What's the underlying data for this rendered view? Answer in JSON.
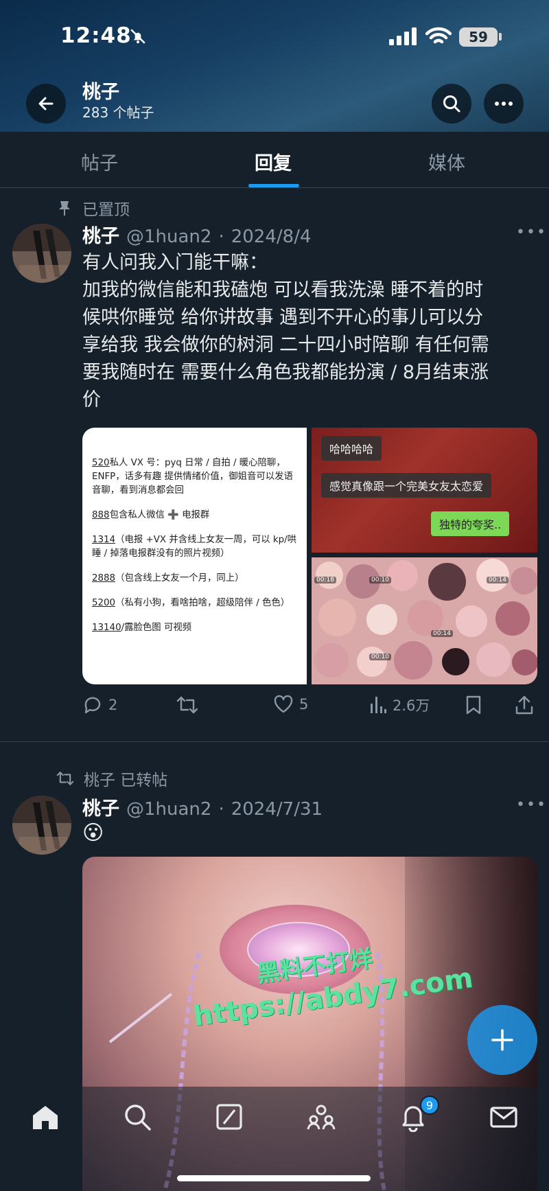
{
  "status_bar": {
    "time": "12:48",
    "battery": "59"
  },
  "header": {
    "name": "桃子",
    "post_count": "283 个帖子"
  },
  "tabs": [
    {
      "label": "帖子"
    },
    {
      "label": "回复"
    },
    {
      "label": "媒体"
    }
  ],
  "posts": [
    {
      "pinned_label": "已置顶",
      "name": "桃子",
      "handle": "@1huan2",
      "date": "2024/8/4",
      "text_lines": [
        "有人问我入门能干嘛：",
        "加我的微信能和我磕炮 可以看我洗澡 睡不着的时",
        "候哄你睡觉 给你讲故事  遇到不开心的事儿可以分",
        "享给我 我会做你的树洞 二十四小时陪聊 有任何需",
        "要我随时在  需要什么角色我都能扮演 / 8月结束涨",
        "价"
      ],
      "media": {
        "doc_lines": [
          [
            "520",
            "私人 VX 号：pyq 日常 / 自拍 / 暖心陪聊，ENFP，话多有趣 提供情绪价值，御姐音可以发语音聊，看到消息都会回"
          ],
          [
            "888",
            "包含私人微信 ➕ 电报群"
          ],
          [
            "1314",
            "（电报 +VX 并含线上女友一周，可以 kp/哄睡 / 掉落电报群没有的照片视频）"
          ],
          [
            "2888",
            "（包含线上女友一个月，同上）"
          ],
          [
            "5200",
            "（私有小狗，看啥拍啥，超级陪伴 / 色色）"
          ],
          [
            "13140",
            "/露脸色图  可视频"
          ]
        ],
        "chat_lines": [
          "哈哈哈哈",
          "感觉真像跟一个完美女友太恋爱",
          "独特的夸奖.."
        ]
      },
      "actions": {
        "replies": "2",
        "likes": "5",
        "views": "2.6万"
      }
    },
    {
      "repost_label": "桃子 已转帖",
      "name": "桃子",
      "handle": "@1huan2",
      "date": "2024/7/31",
      "text": "😮",
      "watermark_lines": [
        "黑料不打烊",
        "https://abdy7.com"
      ]
    }
  ],
  "bottom_nav": {
    "notification_badge": "9"
  },
  "colors": {
    "accent": "#1d9bf0",
    "background": "#15202b",
    "muted": "#8b98a5"
  }
}
